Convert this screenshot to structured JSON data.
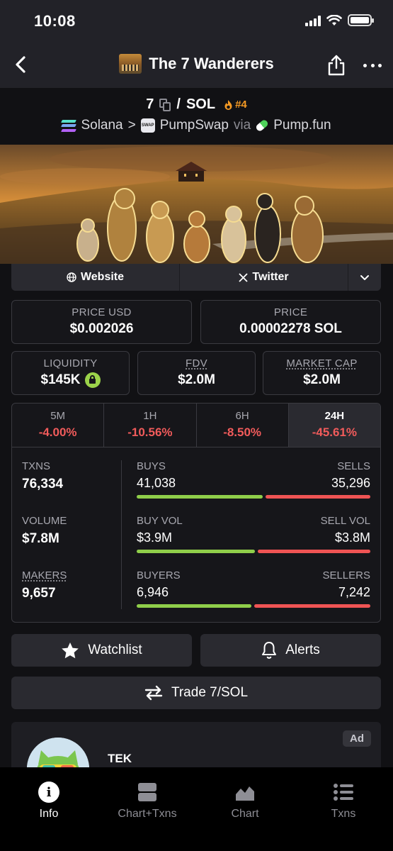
{
  "status_bar": {
    "time": "10:08"
  },
  "nav": {
    "title": "The 7 Wanderers"
  },
  "pair": {
    "base": "7",
    "separator": "/",
    "quote": "SOL",
    "rank": "#4"
  },
  "chain": {
    "network": "Solana",
    "chevron": ">",
    "dex": "PumpSwap",
    "via": "via",
    "launchpad": "Pump.fun"
  },
  "links": {
    "website": "Website",
    "twitter": "Twitter"
  },
  "price": {
    "usd_label": "PRICE USD",
    "usd_value": "$0.002026",
    "native_label": "PRICE",
    "native_value": "0.00002278 SOL"
  },
  "metrics": {
    "liquidity_label": "LIQUIDITY",
    "liquidity_value": "$145K",
    "fdv_label": "FDV",
    "fdv_value": "$2.0M",
    "mcap_label": "MARKET CAP",
    "mcap_value": "$2.0M"
  },
  "timeframes": [
    {
      "label": "5M",
      "change": "-4.00%"
    },
    {
      "label": "1H",
      "change": "-10.56%"
    },
    {
      "label": "6H",
      "change": "-8.50%"
    },
    {
      "label": "24H",
      "change": "-45.61%"
    }
  ],
  "stats": {
    "txns_label": "TXNS",
    "txns_value": "76,334",
    "volume_label": "VOLUME",
    "volume_value": "$7.8M",
    "makers_label": "MAKERS",
    "makers_value": "9,657"
  },
  "splits": {
    "buys_label": "BUYS",
    "sells_label": "SELLS",
    "buys": "41,038",
    "sells": "35,296",
    "buys_share": 0.538,
    "buyvol_label": "BUY VOL",
    "sellvol_label": "SELL VOL",
    "buyvol": "$3.9M",
    "sellvol": "$3.8M",
    "buyvol_share": 0.506,
    "buyers_label": "BUYERS",
    "sellers_label": "SELLERS",
    "buyers": "6,946",
    "sellers": "7,242",
    "buyers_share": 0.49
  },
  "actions": {
    "watchlist": "Watchlist",
    "alerts": "Alerts",
    "trade": "Trade 7/SOL"
  },
  "ad": {
    "badge": "Ad",
    "name": "TEK"
  },
  "tabbar": {
    "info": "Info",
    "chart_txns": "Chart+Txns",
    "chart": "Chart",
    "txns": "Txns"
  },
  "colors": {
    "positive": "#8fce4a",
    "negative": "#ef5454",
    "rank": "#f59a24"
  }
}
